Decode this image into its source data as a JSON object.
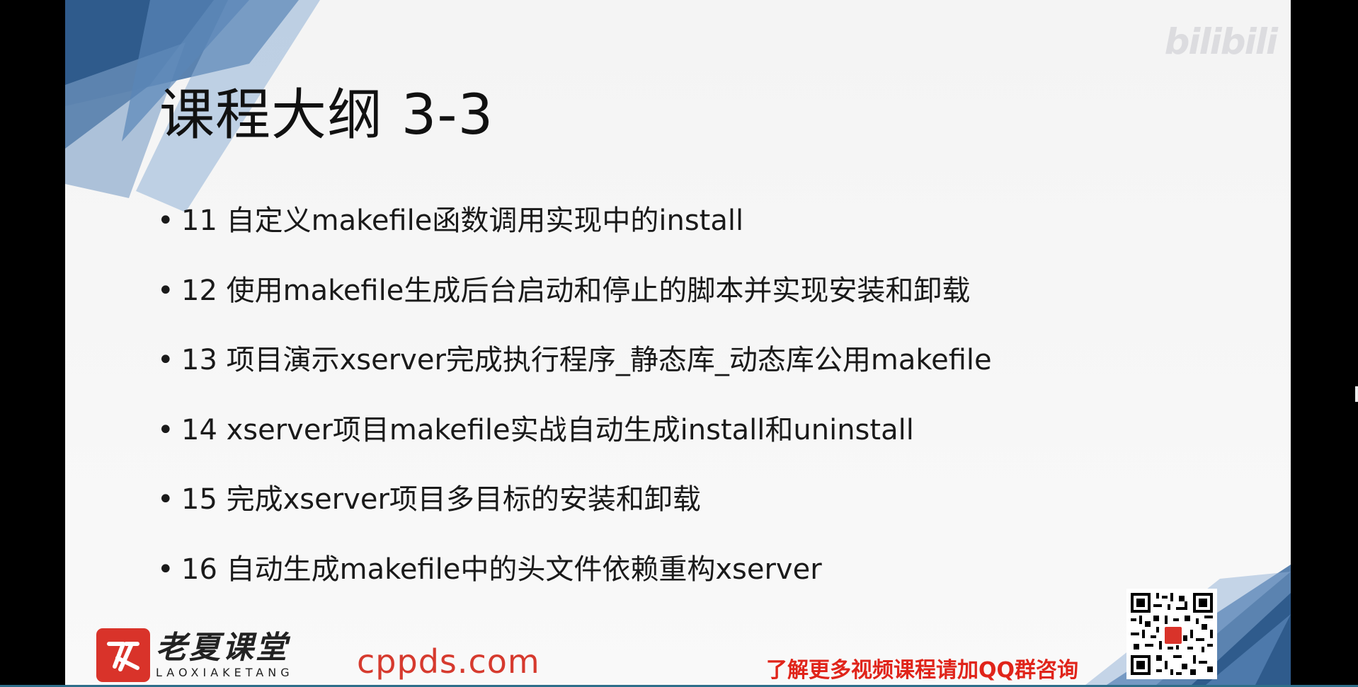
{
  "slide": {
    "title": "课程大纲 3-3",
    "bullet_glyph": "•",
    "items": [
      "11 自定义makefile函数调用实现中的install",
      "12 使用makefile生成后台启动和停止的脚本并实现安装和卸载",
      "13 项目演示xserver完成执行程序_静态库_动态库公用makefile",
      "14 xserver项目makefile实战自动生成install和uninstall",
      "15 完成xserver项目多目标的安装和卸载",
      "16 自动生成makefile中的头文件依赖重构xserver"
    ]
  },
  "branding": {
    "logo_cn": "老夏课堂",
    "logo_en": "LAOXIAKETANG",
    "website": "cppds.com",
    "promo_text": "了解更多视频课程请加QQ群咨询",
    "watermark": "bilibili",
    "qr_icon": "qr-code-icon"
  },
  "colors": {
    "accent_red": "#d9332a",
    "promo_red": "#e0241a",
    "deco_blue": "#3f6ea3"
  }
}
